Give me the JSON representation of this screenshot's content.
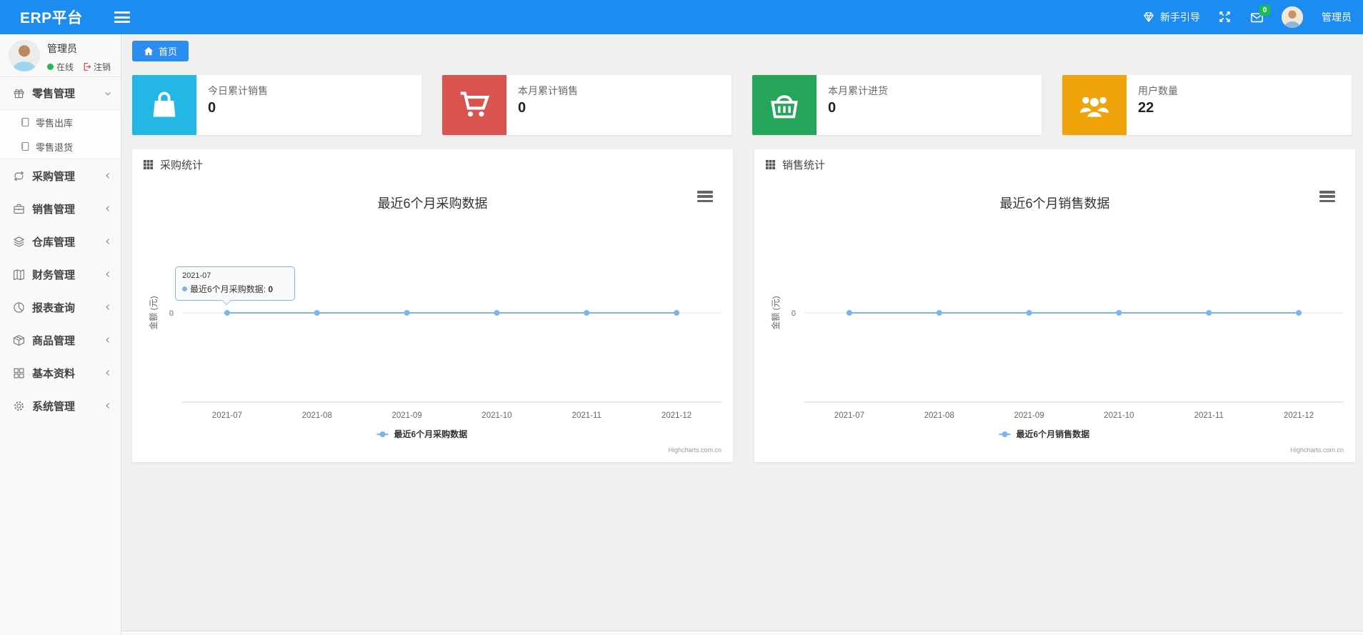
{
  "navbar": {
    "brand": "ERP平台",
    "guide_label": "新手引导",
    "mail_badge": "0",
    "user_name": "管理员",
    "bar_color": "#1d8cf0"
  },
  "sidebar": {
    "user": {
      "name": "管理员",
      "status": "在线",
      "logout_label": "注销",
      "status_color": "#1fba50"
    },
    "items": [
      {
        "label": "零售管理",
        "icon": "gift-icon",
        "expanded": true,
        "children": [
          {
            "label": "零售出库",
            "icon": "journal-icon"
          },
          {
            "label": "零售退货",
            "icon": "journal-icon"
          }
        ]
      },
      {
        "label": "采购管理",
        "icon": "repeat-icon"
      },
      {
        "label": "销售管理",
        "icon": "briefcase-icon"
      },
      {
        "label": "仓库管理",
        "icon": "layers-icon"
      },
      {
        "label": "财务管理",
        "icon": "map-icon"
      },
      {
        "label": "报表查询",
        "icon": "pie-chart-icon"
      },
      {
        "label": "商品管理",
        "icon": "box-icon"
      },
      {
        "label": "基本资料",
        "icon": "grid-icon"
      },
      {
        "label": "系统管理",
        "icon": "gear-icon"
      }
    ]
  },
  "breadcrumb": {
    "home_label": "首页",
    "tab_color": "#2d8cf0"
  },
  "stat_cards": [
    {
      "title": "今日累计销售",
      "value": "0",
      "icon": "bag-icon",
      "color": "#23b7e5"
    },
    {
      "title": "本月累计销售",
      "value": "0",
      "icon": "cart-icon",
      "color": "#d9534f"
    },
    {
      "title": "本月累计进货",
      "value": "0",
      "icon": "basket-icon",
      "color": "#26a65b"
    },
    {
      "title": "用户数量",
      "value": "22",
      "icon": "users-icon",
      "color": "#f0a30a"
    }
  ],
  "panels": [
    {
      "header": "采购统计"
    },
    {
      "header": "销售统计"
    }
  ],
  "chart_data": [
    {
      "type": "line",
      "title": "最近6个月采购数据",
      "categories": [
        "2021-07",
        "2021-08",
        "2021-09",
        "2021-10",
        "2021-11",
        "2021-12"
      ],
      "series": [
        {
          "name": "最近6个月采购数据",
          "values": [
            0,
            0,
            0,
            0,
            0,
            0
          ]
        }
      ],
      "xlabel": "",
      "ylabel": "金额 (元)",
      "yticks": [
        "0"
      ],
      "color": "#7cb5ec",
      "grid": false,
      "legend_position": "bottom",
      "credits": "Highcharts.com.cn",
      "tooltip": {
        "header": "2021-07",
        "label": "最近6个月采购数据",
        "value": "0"
      }
    },
    {
      "type": "line",
      "title": "最近6个月销售数据",
      "categories": [
        "2021-07",
        "2021-08",
        "2021-09",
        "2021-10",
        "2021-11",
        "2021-12"
      ],
      "series": [
        {
          "name": "最近6个月销售数据",
          "values": [
            0,
            0,
            0,
            0,
            0,
            0
          ]
        }
      ],
      "xlabel": "",
      "ylabel": "金额 (元)",
      "yticks": [
        "0"
      ],
      "color": "#7cb5ec",
      "grid": false,
      "legend_position": "bottom",
      "credits": "Highcharts.com.cn"
    }
  ]
}
